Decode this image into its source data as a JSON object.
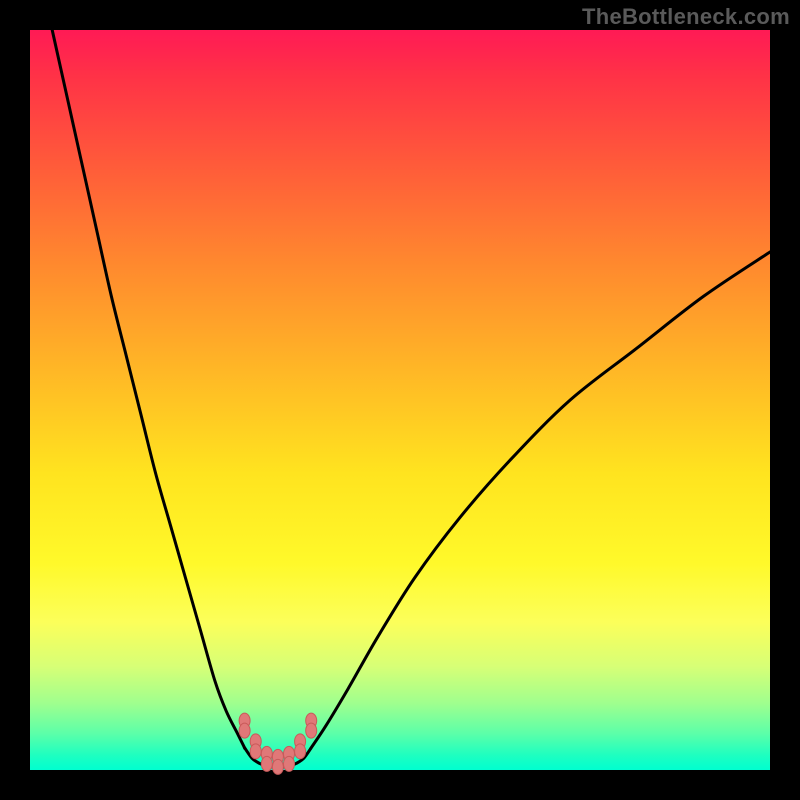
{
  "watermark": "TheBottleneck.com",
  "colors": {
    "frame": "#000000",
    "curve_stroke": "#000000",
    "marker_fill": "#e07878",
    "marker_stroke": "#c85a5a"
  },
  "chart_data": {
    "type": "line",
    "title": "",
    "xlabel": "",
    "ylabel": "",
    "xlim": [
      0,
      100
    ],
    "ylim": [
      0,
      100
    ],
    "series": [
      {
        "name": "left-branch",
        "x": [
          3,
          5,
          7,
          9,
          11,
          13,
          15,
          17,
          19,
          21,
          23,
          25,
          26.5,
          28,
          29
        ],
        "y": [
          100,
          91,
          82,
          73,
          64,
          56,
          48,
          40,
          33,
          26,
          19,
          12,
          8,
          5,
          3
        ]
      },
      {
        "name": "valley",
        "x": [
          29,
          30,
          31,
          32,
          33,
          34,
          35,
          36,
          37,
          38
        ],
        "y": [
          3,
          1.6,
          0.9,
          0.5,
          0.4,
          0.4,
          0.5,
          0.9,
          1.6,
          3
        ]
      },
      {
        "name": "right-branch",
        "x": [
          38,
          40,
          43,
          47,
          52,
          58,
          65,
          73,
          82,
          91,
          100
        ],
        "y": [
          3,
          6,
          11,
          18,
          26,
          34,
          42,
          50,
          57,
          64,
          70
        ]
      }
    ],
    "markers": {
      "name": "valley-points",
      "x": [
        29,
        30.5,
        32,
        33.5,
        35,
        36.5,
        38
      ],
      "y": [
        6,
        3.2,
        1.5,
        1.1,
        1.5,
        3.2,
        6
      ],
      "size": 10
    },
    "gradient_stops": [
      {
        "pos": 0,
        "color": "#ff1a55"
      },
      {
        "pos": 18,
        "color": "#ff5a3a"
      },
      {
        "pos": 46,
        "color": "#ffb726"
      },
      {
        "pos": 72,
        "color": "#fff92a"
      },
      {
        "pos": 91,
        "color": "#9fff8e"
      },
      {
        "pos": 100,
        "color": "#00ffd0"
      }
    ]
  }
}
